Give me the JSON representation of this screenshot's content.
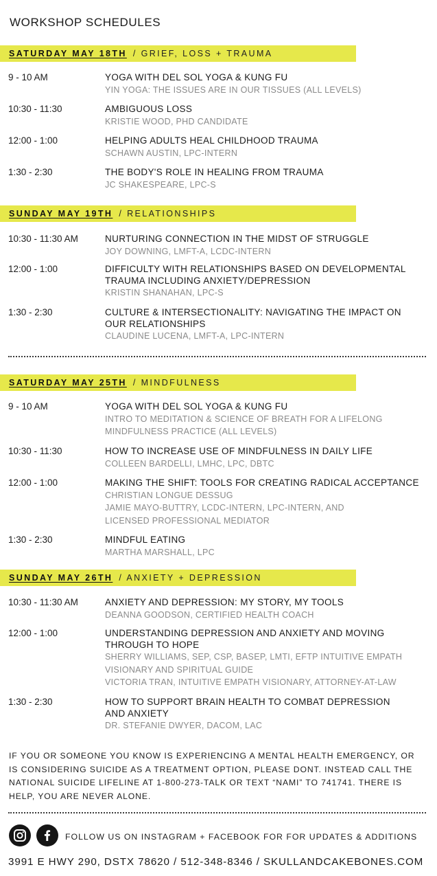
{
  "header": {
    "title": "WORKSHOP SCHEDULES"
  },
  "days": [
    {
      "date": "SATURDAY MAY 18TH",
      "theme": "/ GRIEF, LOSS + TRAUMA",
      "sessions": [
        {
          "time": "9 - 10 AM",
          "title": "YOGA WITH DEL SOL YOGA & KUNG FU",
          "details": [
            "YIN YOGA: THE ISSUES ARE IN OUR TISSUES (ALL LEVELS)"
          ]
        },
        {
          "time": "10:30 - 11:30",
          "title": "AMBIGUOUS LOSS",
          "details": [
            "KRISTIE WOOD, PHD CANDIDATE"
          ]
        },
        {
          "time": "12:00 - 1:00",
          "title": "HELPING ADULTS HEAL CHILDHOOD TRAUMA",
          "details": [
            "SCHAWN AUSTIN, LPC-INTERN"
          ]
        },
        {
          "time": "1:30 - 2:30",
          "title": "THE BODY'S ROLE IN HEALING FROM TRAUMA",
          "details": [
            "JC SHAKESPEARE, LPC-S"
          ]
        }
      ]
    },
    {
      "date": "SUNDAY MAY 19TH",
      "theme": "/ RELATIONSHIPS",
      "sessions": [
        {
          "time": "10:30 - 11:30 AM",
          "title": "NURTURING CONNECTION IN THE MIDST OF STRUGGLE",
          "details": [
            "JOY DOWNING, LMFT-A, LCDC-INTERN"
          ]
        },
        {
          "time": "12:00 - 1:00",
          "title": "DIFFICULTY WITH RELATIONSHIPS BASED ON DEVELOPMENTAL TRAUMA INCLUDING ANXIETY/DEPRESSION",
          "details": [
            "KRISTIN SHANAHAN, LPC-S"
          ]
        },
        {
          "time": "1:30 - 2:30",
          "title": "CULTURE & INTERSECTIONALITY: NAVIGATING THE IMPACT ON OUR RELATIONSHIPS",
          "details": [
            "CLAUDINE LUCENA, LMFT-A, LPC-INTERN"
          ]
        }
      ]
    },
    {
      "date": "SATURDAY MAY 25TH",
      "theme": "/ MINDFULNESS",
      "sessions": [
        {
          "time": "9 - 10 AM",
          "title": "YOGA WITH DEL SOL YOGA & KUNG FU",
          "details": [
            "INTRO TO MEDITATION & SCIENCE OF BREATH FOR A LIFELONG MINDFULNESS PRACTICE (ALL LEVELS)"
          ]
        },
        {
          "time": "10:30 - 11:30",
          "title": "HOW TO INCREASE USE OF MINDFULNESS IN DAILY LIFE",
          "details": [
            "COLLEEN BARDELLI, LMHC, LPC, DBTC"
          ]
        },
        {
          "time": "12:00 - 1:00",
          "title": "MAKING THE SHIFT: TOOLS FOR CREATING RADICAL ACCEPTANCE",
          "details": [
            "CHRISTIAN LONGUE DESSUG",
            "JAMIE MAYO-BUTTRY, LCDC-INTERN, LPC-INTERN, AND",
            "LICENSED PROFESSIONAL MEDIATOR"
          ]
        },
        {
          "time": "1:30 - 2:30",
          "title": "MINDFUL EATING",
          "details": [
            "MARTHA MARSHALL, LPC"
          ]
        }
      ]
    },
    {
      "date": "SUNDAY MAY 26TH",
      "theme": "/ ANXIETY + DEPRESSION",
      "sessions": [
        {
          "time": "10:30 - 11:30 AM",
          "title": "ANXIETY AND DEPRESSION: MY STORY, MY TOOLS",
          "details": [
            "DEANNA GOODSON, CERTIFIED HEALTH COACH"
          ]
        },
        {
          "time": "12:00 - 1:00",
          "title": "UNDERSTANDING DEPRESSION AND ANXIETY AND MOVING THROUGH TO HOPE",
          "details": [
            "SHERRY WILLIAMS, SEP, CSP, BASEP, LMTI, EFTP INTUITIVE EMPATH VISIONARY AND SPIRITUAL GUIDE",
            "VICTORIA TRAN, INTUITIVE EMPATH VISIONARY, ATTORNEY-AT-LAW"
          ]
        },
        {
          "time": "1:30 - 2:30",
          "title": "HOW TO SUPPORT BRAIN HEALTH TO COMBAT DEPRESSION AND ANXIETY",
          "details": [
            "DR. STEFANIE DWYER, DACOM, LAC"
          ]
        }
      ]
    }
  ],
  "notice": "IF YOU OR SOMEONE YOU KNOW IS EXPERIENCING A MENTAL HEALTH EMERGENCY, OR IS CONSIDERING SUICIDE AS A TREATMENT OPTION, PLEASE DONT. INSTEAD CALL THE NATIONAL SUICIDE LIFELINE AT 1-800-273-TALK OR TEXT “NAMI” TO 741741. THERE IS HELP, YOU ARE NEVER ALONE.",
  "social": {
    "text": "FOLLOW US ON INSTAGRAM + FACEBOOK FOR FOR UPDATES & ADDITIONS",
    "icons": [
      "instagram-icon",
      "facebook-icon"
    ]
  },
  "footer": {
    "address": "3991 E HWY 290, DSTX 78620 / 512-348-8346 / SKULLANDCAKEBONES.COM"
  },
  "colors": {
    "banner": "#e6e84b",
    "text": "#1c1c1c",
    "subtext": "#8a8a8a"
  }
}
